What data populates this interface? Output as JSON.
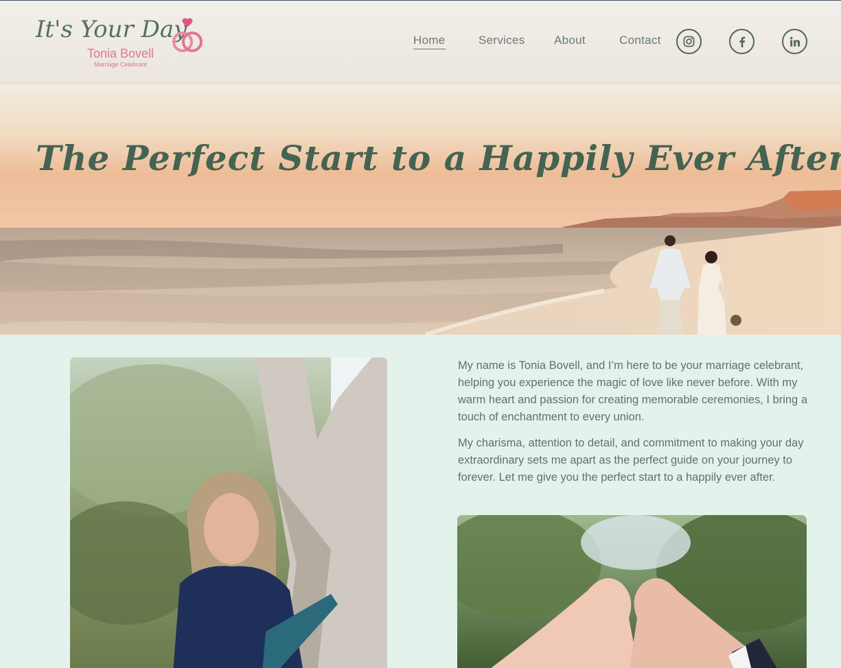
{
  "brand": {
    "script": "It's Your Day",
    "name": "Tonia Bovell",
    "tagline": "Marriage Celebrant",
    "accent": "#e27591",
    "green": "#436353"
  },
  "nav": {
    "items": [
      {
        "label": "Home",
        "active": true
      },
      {
        "label": "Services",
        "active": false
      },
      {
        "label": "About",
        "active": false
      },
      {
        "label": "Contact",
        "active": false
      }
    ],
    "social": [
      "instagram-icon",
      "facebook-icon",
      "linkedin-icon"
    ]
  },
  "hero": {
    "title": "The Perfect Start to a Happily Ever After"
  },
  "about": {
    "paragraphs": [
      "My name is Tonia Bovell, and I’m here to be your marriage celebrant, helping you experience the magic of love like never before. With my warm heart and passion for creating memorable ceremonies, I bring a touch of enchantment to every union.",
      "My charisma, attention to detail, and commitment to making your day extraordinary sets me apart as the perfect guide on your journey to forever. Let me give you the perfect start to a happily ever after."
    ]
  },
  "colors": {
    "background": "#e3f3ec",
    "header_bg": "#eeebe4",
    "text": "#5f726a"
  }
}
